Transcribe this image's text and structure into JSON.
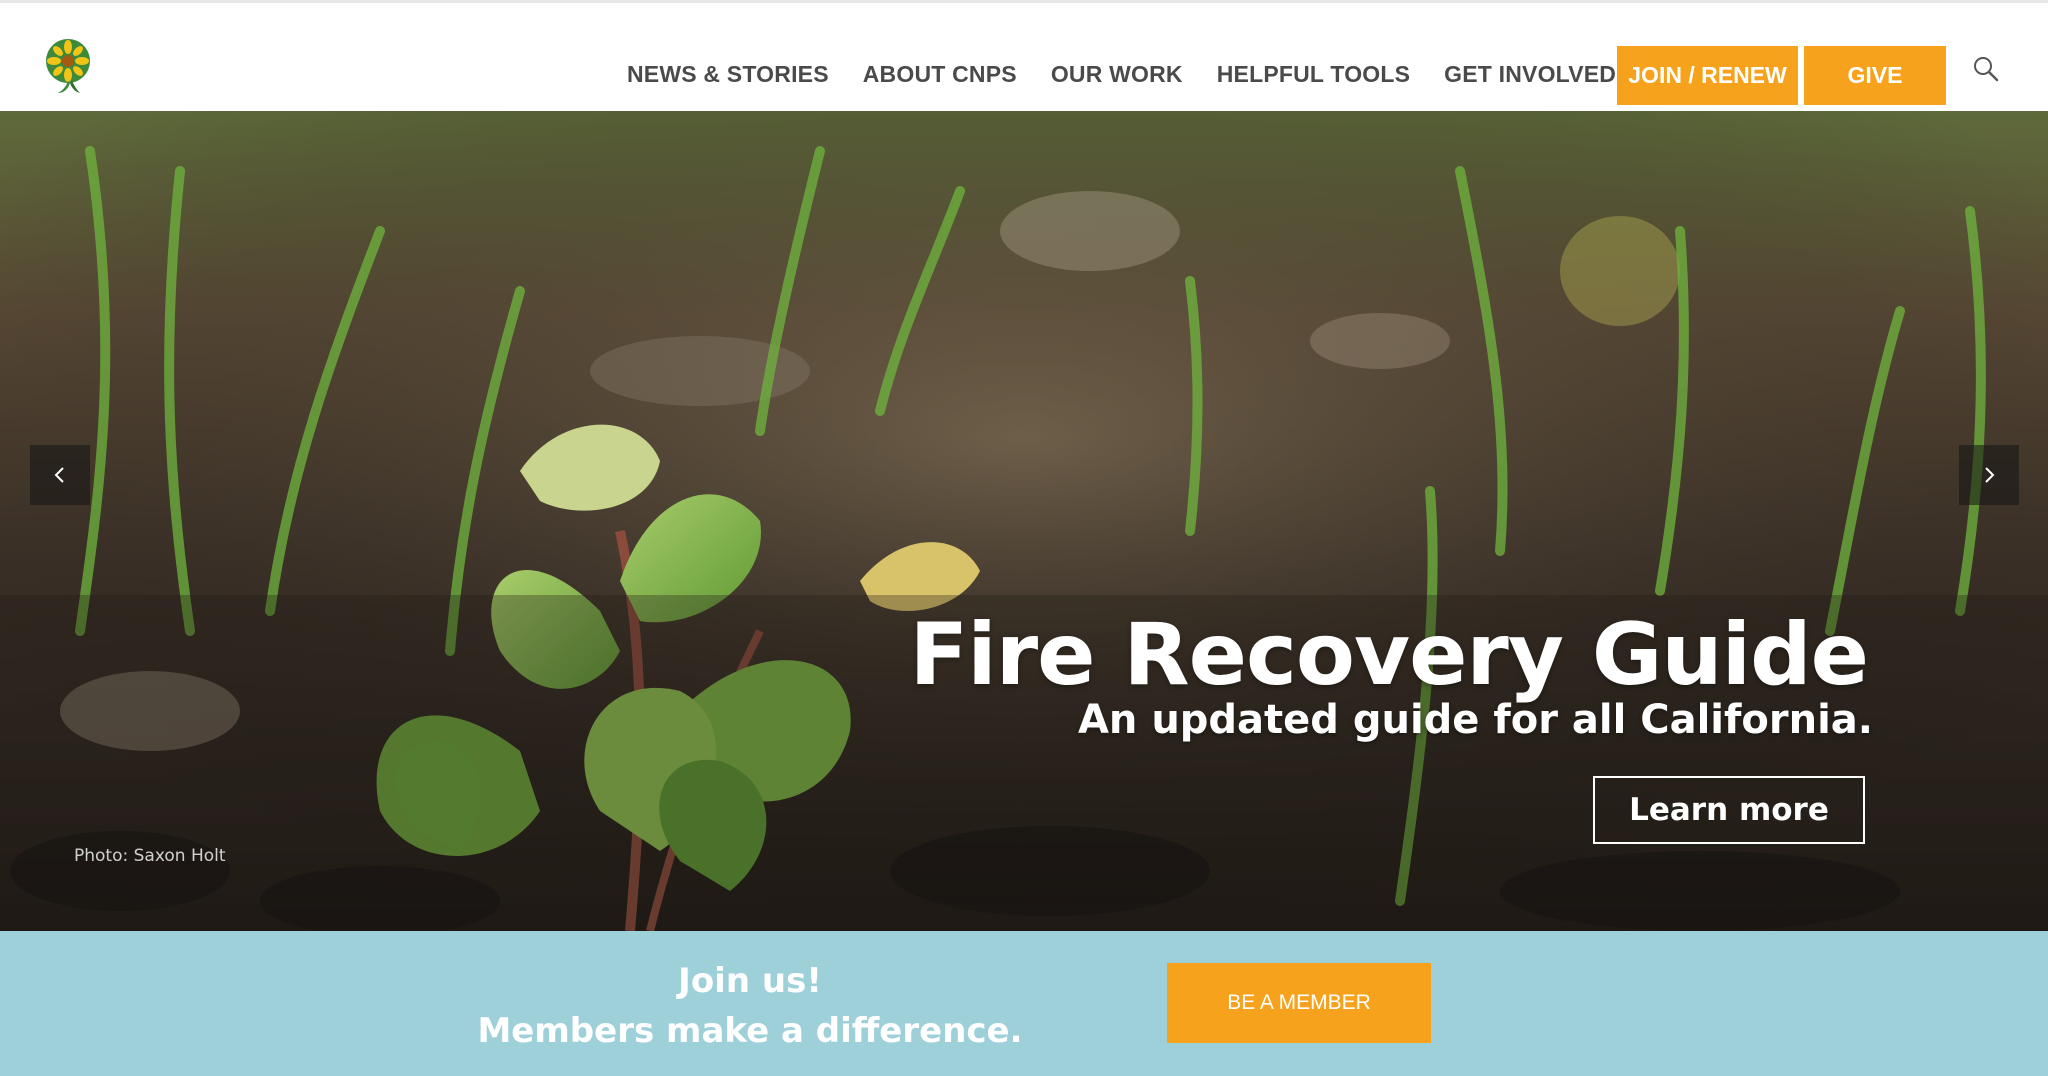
{
  "header": {
    "logo_name": "cnps-flower-logo",
    "nav": [
      {
        "label": "NEWS & STORIES"
      },
      {
        "label": "ABOUT CNPS"
      },
      {
        "label": "OUR WORK"
      },
      {
        "label": "HELPFUL TOOLS"
      },
      {
        "label": "GET INVOLVED"
      }
    ],
    "join_label": "JOIN / RENEW",
    "give_label": "GIVE",
    "search_icon": "search-icon"
  },
  "hero": {
    "title": "Fire Recovery Guide",
    "subtitle": "An updated guide for all California.",
    "cta_label": "Learn more",
    "photo_credit": "Photo: Saxon Holt",
    "prev_icon": "chevron-left-icon",
    "next_icon": "chevron-right-icon"
  },
  "member": {
    "line1": "Join us!",
    "line2": "Members make a difference.",
    "button_label": "BE A MEMBER"
  },
  "colors": {
    "accent_orange": "#f7a21c",
    "member_bar": "#9ed0da",
    "nav_text": "#4a4a4a"
  }
}
